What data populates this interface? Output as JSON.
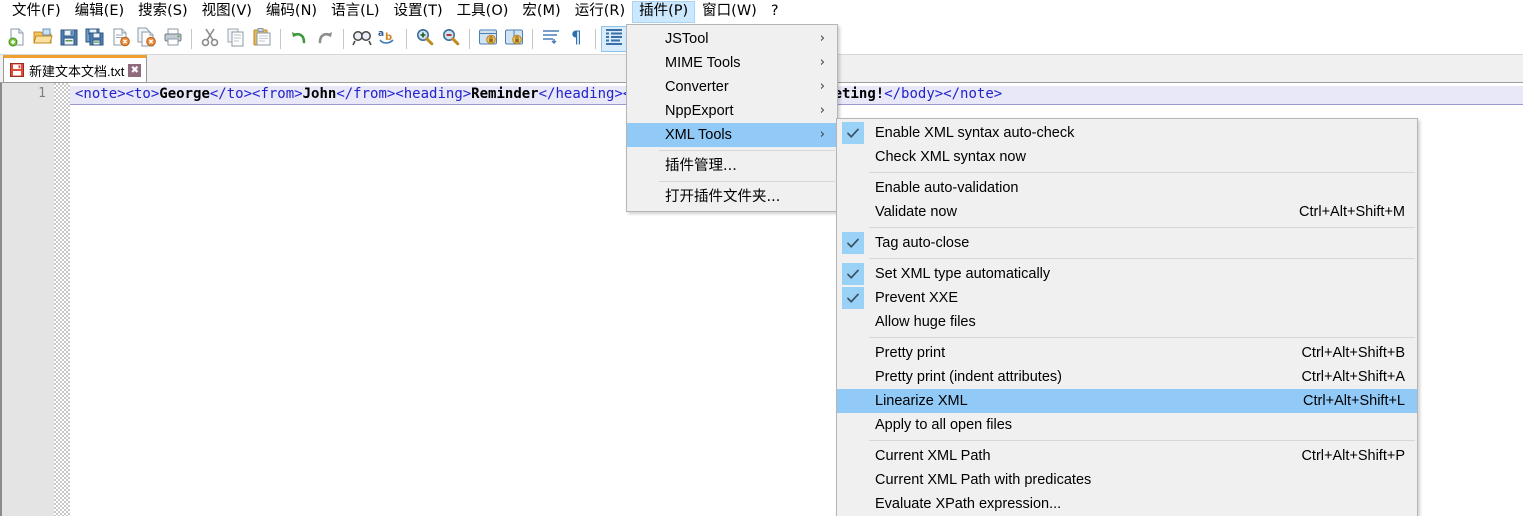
{
  "menubar": {
    "items": [
      {
        "label": "文件(F)",
        "name": "menu-file",
        "active": false
      },
      {
        "label": "编辑(E)",
        "name": "menu-edit",
        "active": false
      },
      {
        "label": "搜索(S)",
        "name": "menu-search",
        "active": false
      },
      {
        "label": "视图(V)",
        "name": "menu-view",
        "active": false
      },
      {
        "label": "编码(N)",
        "name": "menu-encoding",
        "active": false
      },
      {
        "label": "语言(L)",
        "name": "menu-language",
        "active": false
      },
      {
        "label": "设置(T)",
        "name": "menu-settings",
        "active": false
      },
      {
        "label": "工具(O)",
        "name": "menu-tools",
        "active": false
      },
      {
        "label": "宏(M)",
        "name": "menu-macro",
        "active": false
      },
      {
        "label": "运行(R)",
        "name": "menu-run",
        "active": false
      },
      {
        "label": "插件(P)",
        "name": "menu-plugins",
        "active": true
      },
      {
        "label": "窗口(W)",
        "name": "menu-window",
        "active": false
      },
      {
        "label": "?",
        "name": "menu-help",
        "active": false
      }
    ]
  },
  "toolbar": {
    "buttons": [
      {
        "icon": "new-file-icon",
        "name": "toolbar-new"
      },
      {
        "icon": "open-folder-icon",
        "name": "toolbar-open"
      },
      {
        "icon": "save-icon",
        "name": "toolbar-save"
      },
      {
        "icon": "save-all-icon",
        "name": "toolbar-save-all"
      },
      {
        "icon": "close-file-icon",
        "name": "toolbar-close"
      },
      {
        "icon": "close-all-icon",
        "name": "toolbar-close-all"
      },
      {
        "icon": "print-icon",
        "name": "toolbar-print"
      },
      {
        "icon": "separator",
        "name": "toolbar-sep-1"
      },
      {
        "icon": "cut-icon",
        "name": "toolbar-cut"
      },
      {
        "icon": "copy-icon",
        "name": "toolbar-copy"
      },
      {
        "icon": "paste-icon",
        "name": "toolbar-paste"
      },
      {
        "icon": "separator",
        "name": "toolbar-sep-2"
      },
      {
        "icon": "undo-icon",
        "name": "toolbar-undo"
      },
      {
        "icon": "redo-icon",
        "name": "toolbar-redo"
      },
      {
        "icon": "separator",
        "name": "toolbar-sep-3"
      },
      {
        "icon": "find-icon",
        "name": "toolbar-find"
      },
      {
        "icon": "replace-icon",
        "name": "toolbar-replace"
      },
      {
        "icon": "separator",
        "name": "toolbar-sep-4"
      },
      {
        "icon": "zoom-in-icon",
        "name": "toolbar-zoom-in"
      },
      {
        "icon": "zoom-out-icon",
        "name": "toolbar-zoom-out"
      },
      {
        "icon": "separator",
        "name": "toolbar-sep-5"
      },
      {
        "icon": "sync-vertical-icon",
        "name": "toolbar-sync-v"
      },
      {
        "icon": "sync-horizontal-icon",
        "name": "toolbar-sync-h"
      },
      {
        "icon": "separator",
        "name": "toolbar-sep-6"
      },
      {
        "icon": "word-wrap-icon",
        "name": "toolbar-word-wrap"
      },
      {
        "icon": "show-symbol-icon",
        "name": "toolbar-show-symbol"
      },
      {
        "icon": "separator",
        "name": "toolbar-sep-7"
      },
      {
        "icon": "show-indent-guide-icon",
        "name": "toolbar-indent-guide",
        "on": true
      },
      {
        "icon": "user-define-icon",
        "name": "toolbar-user-define"
      },
      {
        "icon": "separator",
        "name": "toolbar-sep-8"
      },
      {
        "icon": "macro-play-icon",
        "name": "toolbar-macro-play"
      },
      {
        "icon": "macro-record-icon",
        "name": "toolbar-macro-record"
      },
      {
        "icon": "separator",
        "name": "toolbar-sep-9"
      },
      {
        "icon": "jstool-icon",
        "name": "toolbar-jstool"
      }
    ]
  },
  "tab": {
    "label": "新建文本文档.txt",
    "save_icon": "floppy-disk-icon",
    "close_icon": "✖"
  },
  "editor": {
    "line_number": "1",
    "code_segments": [
      {
        "t": "tag",
        "s": "<note><to>"
      },
      {
        "t": "txt",
        "s": "George"
      },
      {
        "t": "tag",
        "s": "</to><from>"
      },
      {
        "t": "txt",
        "s": "John"
      },
      {
        "t": "tag",
        "s": "</from><heading>"
      },
      {
        "t": "txt",
        "s": "Reminder"
      },
      {
        "t": "tag",
        "s": "</heading><body>"
      },
      {
        "t": "txt",
        "s": "Don't forget the meeting!"
      },
      {
        "t": "tag",
        "s": "</body></note>"
      }
    ]
  },
  "plugins_menu": {
    "items": [
      {
        "label": "JSTool",
        "name": "plugins-item-jstool",
        "arrow": "›",
        "selected": false
      },
      {
        "label": "MIME Tools",
        "name": "plugins-item-mime-tools",
        "arrow": "›",
        "selected": false
      },
      {
        "label": "Converter",
        "name": "plugins-item-converter",
        "arrow": "›",
        "selected": false
      },
      {
        "label": "NppExport",
        "name": "plugins-item-nppexport",
        "arrow": "›",
        "selected": false
      },
      {
        "label": "XML Tools",
        "name": "plugins-item-xml-tools",
        "arrow": "›",
        "selected": true
      },
      {
        "separator": true,
        "name": "plugins-sep-1"
      },
      {
        "label": "插件管理...",
        "name": "plugins-item-plugin-admin",
        "cjk": true,
        "selected": false
      },
      {
        "separator": true,
        "name": "plugins-sep-2"
      },
      {
        "label": "打开插件文件夹...",
        "name": "plugins-item-open-plugins-folder",
        "cjk": true,
        "selected": false
      }
    ]
  },
  "xmltools_menu": {
    "items": [
      {
        "label": "Enable XML syntax auto-check",
        "name": "xmltools-item-enable-auto-check",
        "checked": true,
        "accel": "",
        "selected": false
      },
      {
        "label": "Check XML syntax now",
        "name": "xmltools-item-check-syntax-now",
        "checked": false,
        "accel": "",
        "selected": false
      },
      {
        "separator": true,
        "name": "xmltools-sep-1"
      },
      {
        "label": "Enable auto-validation",
        "name": "xmltools-item-enable-auto-validation",
        "checked": false,
        "accel": "",
        "selected": false
      },
      {
        "label": "Validate now",
        "name": "xmltools-item-validate-now",
        "checked": false,
        "accel": "Ctrl+Alt+Shift+M",
        "selected": false
      },
      {
        "separator": true,
        "name": "xmltools-sep-2"
      },
      {
        "label": "Tag auto-close",
        "name": "xmltools-item-tag-auto-close",
        "checked": true,
        "accel": "",
        "selected": false
      },
      {
        "separator": true,
        "name": "xmltools-sep-3"
      },
      {
        "label": "Set XML type automatically",
        "name": "xmltools-item-set-xml-type",
        "checked": true,
        "accel": "",
        "selected": false
      },
      {
        "label": "Prevent XXE",
        "name": "xmltools-item-prevent-xxe",
        "checked": true,
        "accel": "",
        "selected": false
      },
      {
        "label": "Allow huge files",
        "name": "xmltools-item-allow-huge-files",
        "checked": false,
        "accel": "",
        "selected": false
      },
      {
        "separator": true,
        "name": "xmltools-sep-4"
      },
      {
        "label": "Pretty print",
        "name": "xmltools-item-pretty-print",
        "checked": false,
        "accel": "Ctrl+Alt+Shift+B",
        "selected": false
      },
      {
        "label": "Pretty print (indent attributes)",
        "name": "xmltools-item-pretty-print-indent",
        "checked": false,
        "accel": "Ctrl+Alt+Shift+A",
        "selected": false
      },
      {
        "label": "Linearize XML",
        "name": "xmltools-item-linearize-xml",
        "checked": false,
        "accel": "Ctrl+Alt+Shift+L",
        "selected": true
      },
      {
        "label": "Apply to all open files",
        "name": "xmltools-item-apply-all-files",
        "checked": false,
        "accel": "",
        "selected": false
      },
      {
        "separator": true,
        "name": "xmltools-sep-5"
      },
      {
        "label": "Current XML Path",
        "name": "xmltools-item-current-xml-path",
        "checked": false,
        "accel": "Ctrl+Alt+Shift+P",
        "selected": false
      },
      {
        "label": "Current XML Path with predicates",
        "name": "xmltools-item-current-xml-path-predicates",
        "checked": false,
        "accel": "",
        "selected": false
      },
      {
        "label": "Evaluate XPath expression...",
        "name": "xmltools-item-evaluate-xpath",
        "checked": false,
        "accel": "",
        "selected": false
      }
    ]
  },
  "colors": {
    "menu_highlight": "#91c9f7",
    "menubar_active": "#cce8ff",
    "menu_bg": "#f0f0f0",
    "tab_accent": "#f0a030",
    "code_tag": "#2222cc",
    "code_text": "#000000",
    "current_line": "#e8e8f8"
  }
}
